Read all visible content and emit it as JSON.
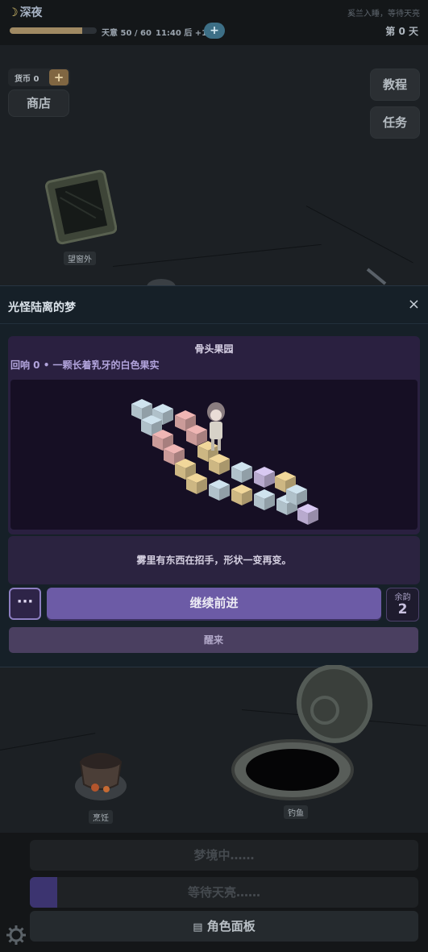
{
  "hud": {
    "time_of_day": "深夜",
    "moon_icon": "☽",
    "hint": "奚兰入睡，等待天亮",
    "stamina": "天意 50 / 60",
    "stamina_fraction": 0.83,
    "clock": "11:40 后 +1",
    "plus": "+",
    "day": "第 0 天"
  },
  "currency": {
    "label": "货币 0",
    "plus": "+"
  },
  "buttons": {
    "shop": "商店",
    "tutorial": "教程",
    "tasks": "任务"
  },
  "map": {
    "window_label": "望窗外",
    "cook_label": "烹饪",
    "fish_label": "钓鱼"
  },
  "modal": {
    "title": "光怪陆离的梦",
    "close": "×",
    "dream_name": "骨头果园",
    "echo": "回响 0  •  一颗长着乳牙的白色果实",
    "story": "雾里有东西在招手，形状一变再变。",
    "more": "···",
    "advance": "继续前进",
    "remaining_label": "余韵",
    "remaining_value": "2",
    "wake": "醒来"
  },
  "bottom": {
    "dreaming": "梦境中……",
    "waiting": "等待天亮……",
    "waiting_progress": 0.07,
    "character_panel": "角色面板",
    "panel_icon": "▤"
  },
  "colors": {
    "cube_blue": "#cfe3ee",
    "cube_pink": "#efb6b4",
    "cube_yellow": "#f1d79a",
    "cube_purple": "#d8c8f2",
    "accent": "#6c5ba6"
  }
}
